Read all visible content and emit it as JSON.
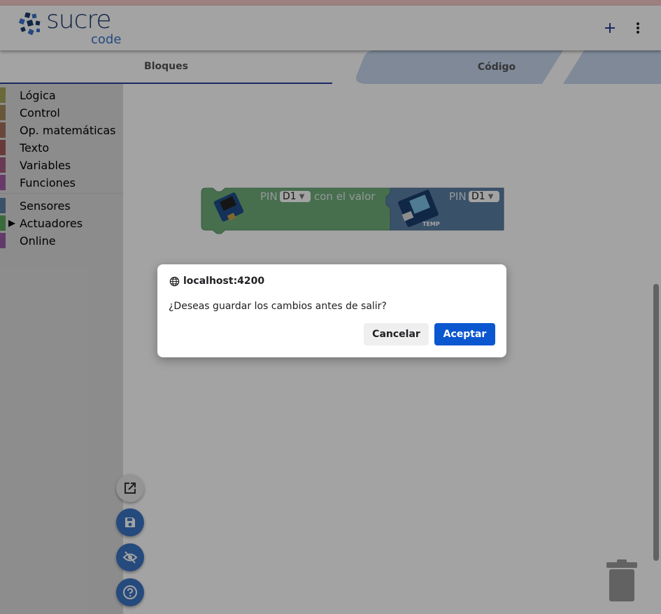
{
  "header": {
    "logo_text": "sucre",
    "logo_sub": "code",
    "plus_label": "+",
    "colors": {
      "brand": "#1d3a6e",
      "accent": "#3b74c4"
    }
  },
  "tabs": [
    {
      "label": "Bloques",
      "active": true
    },
    {
      "label": "Código",
      "active": false
    }
  ],
  "toolbox": {
    "categories": [
      {
        "label": "Lógica",
        "color": "#a5a55b"
      },
      {
        "label": "Control",
        "color": "#a5895b"
      },
      {
        "label": "Op. matemáticas",
        "color": "#a56f5b"
      },
      {
        "label": "Texto",
        "color": "#a55b5b"
      },
      {
        "label": "Variables",
        "color": "#a55b80"
      },
      {
        "label": "Funciones",
        "color": "#a55ba5"
      },
      {
        "label": "Sensores",
        "color": "#5b80a5"
      },
      {
        "label": "Actuadores",
        "color": "#5ba55b",
        "expanded_arrow": "▶"
      },
      {
        "label": "Online",
        "color": "#9a5ba5"
      }
    ]
  },
  "blocks": {
    "actuator": {
      "pin_label": "PIN",
      "pin_value": "D1",
      "suffix": "con el valor",
      "color": "#6fae7a"
    },
    "sensor": {
      "pin_label": "PIN",
      "pin_value": "D1",
      "image_caption": "TEMP",
      "color": "#5b80a5"
    }
  },
  "dialog": {
    "origin": "localhost:4200",
    "message": "¿Deseas guardar los cambios antes de salir?",
    "cancel_label": "Cancelar",
    "ok_label": "Aceptar"
  },
  "fabs": {
    "icons": [
      "open-in-new-icon",
      "save-icon",
      "visibility-off-icon",
      "help-icon"
    ]
  }
}
